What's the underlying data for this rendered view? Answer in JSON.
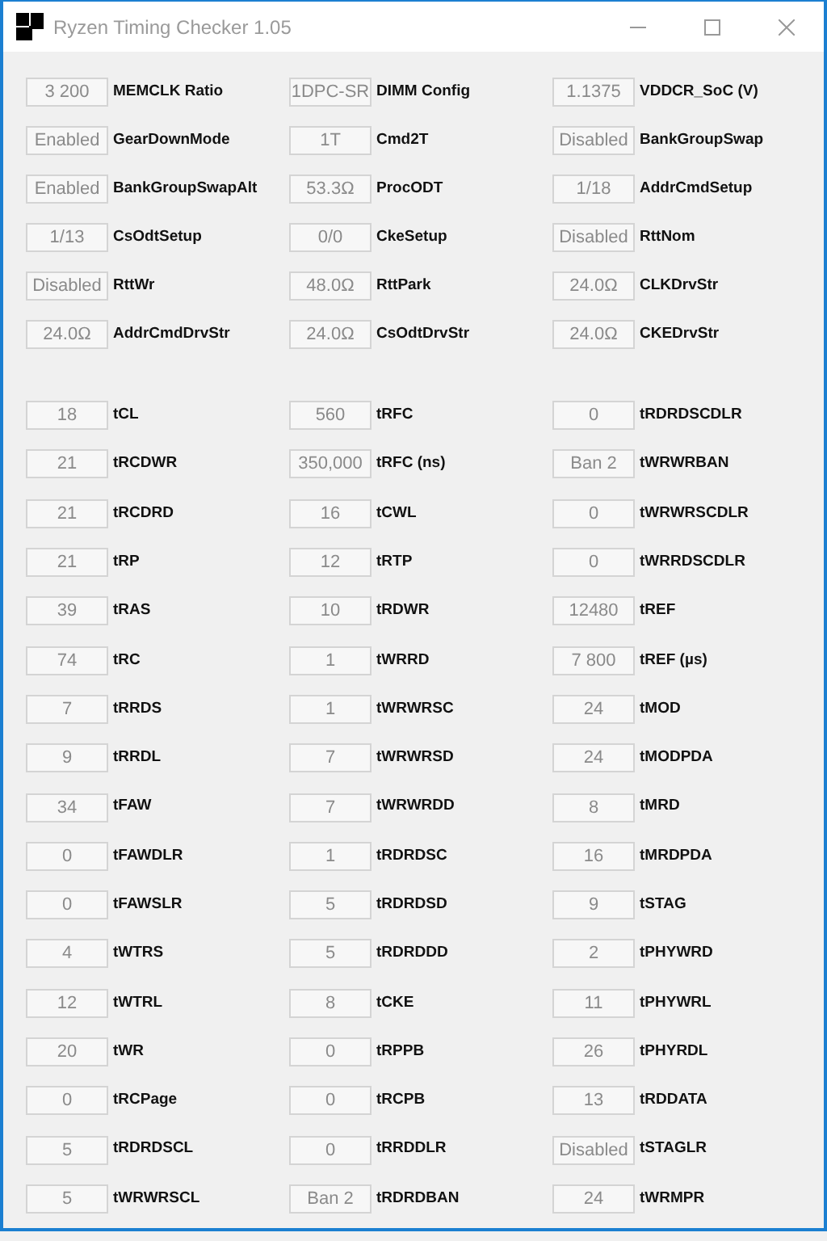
{
  "window": {
    "title": "Ryzen Timing Checker 1.05"
  },
  "settings": [
    {
      "value": "3 200",
      "label": "MEMCLK Ratio"
    },
    {
      "value": "1DPC-SR",
      "label": "DIMM Config"
    },
    {
      "value": "1.1375",
      "label": "VDDCR_SoC (V)"
    },
    {
      "value": "Enabled",
      "label": "GearDownMode"
    },
    {
      "value": "1T",
      "label": "Cmd2T"
    },
    {
      "value": "Disabled",
      "label": "BankGroupSwap"
    },
    {
      "value": "Enabled",
      "label": "BankGroupSwapAlt"
    },
    {
      "value": "53.3Ω",
      "label": "ProcODT"
    },
    {
      "value": "1/18",
      "label": "AddrCmdSetup"
    },
    {
      "value": "1/13",
      "label": "CsOdtSetup"
    },
    {
      "value": "0/0",
      "label": "CkeSetup"
    },
    {
      "value": "Disabled",
      "label": "RttNom"
    },
    {
      "value": "Disabled",
      "label": "RttWr"
    },
    {
      "value": "48.0Ω",
      "label": "RttPark"
    },
    {
      "value": "24.0Ω",
      "label": "CLKDrvStr"
    },
    {
      "value": "24.0Ω",
      "label": "AddrCmdDrvStr"
    },
    {
      "value": "24.0Ω",
      "label": "CsOdtDrvStr"
    },
    {
      "value": "24.0Ω",
      "label": "CKEDrvStr"
    }
  ],
  "timings": [
    {
      "value": "18",
      "label": "tCL"
    },
    {
      "value": "560",
      "label": "tRFC"
    },
    {
      "value": "0",
      "label": "tRDRDSCDLR"
    },
    {
      "value": "21",
      "label": "tRCDWR"
    },
    {
      "value": "350,000",
      "label": "tRFC (ns)"
    },
    {
      "value": "Ban 2",
      "label": "tWRWRBAN"
    },
    {
      "value": "21",
      "label": "tRCDRD"
    },
    {
      "value": "16",
      "label": "tCWL"
    },
    {
      "value": "0",
      "label": "tWRWRSCDLR"
    },
    {
      "value": "21",
      "label": "tRP"
    },
    {
      "value": "12",
      "label": "tRTP"
    },
    {
      "value": "0",
      "label": "tWRRDSCDLR"
    },
    {
      "value": "39",
      "label": "tRAS"
    },
    {
      "value": "10",
      "label": "tRDWR"
    },
    {
      "value": "12480",
      "label": "tREF"
    },
    {
      "value": "74",
      "label": "tRC"
    },
    {
      "value": "1",
      "label": "tWRRD"
    },
    {
      "value": "7 800",
      "label": "tREF (µs)"
    },
    {
      "value": "7",
      "label": "tRRDS"
    },
    {
      "value": "1",
      "label": "tWRWRSC"
    },
    {
      "value": "24",
      "label": "tMOD"
    },
    {
      "value": "9",
      "label": "tRRDL"
    },
    {
      "value": "7",
      "label": "tWRWRSD"
    },
    {
      "value": "24",
      "label": "tMODPDA"
    },
    {
      "value": "34",
      "label": "tFAW"
    },
    {
      "value": "7",
      "label": "tWRWRDD"
    },
    {
      "value": "8",
      "label": "tMRD"
    },
    {
      "value": "0",
      "label": "tFAWDLR"
    },
    {
      "value": "1",
      "label": "tRDRDSC"
    },
    {
      "value": "16",
      "label": "tMRDPDA"
    },
    {
      "value": "0",
      "label": "tFAWSLR"
    },
    {
      "value": "5",
      "label": "tRDRDSD"
    },
    {
      "value": "9",
      "label": "tSTAG"
    },
    {
      "value": "4",
      "label": "tWTRS"
    },
    {
      "value": "5",
      "label": "tRDRDDD"
    },
    {
      "value": "2",
      "label": "tPHYWRD"
    },
    {
      "value": "12",
      "label": "tWTRL"
    },
    {
      "value": "8",
      "label": "tCKE"
    },
    {
      "value": "11",
      "label": "tPHYWRL"
    },
    {
      "value": "20",
      "label": "tWR"
    },
    {
      "value": "0",
      "label": "tRPPB"
    },
    {
      "value": "26",
      "label": "tPHYRDL"
    },
    {
      "value": "0",
      "label": "tRCPage"
    },
    {
      "value": "0",
      "label": "tRCPB"
    },
    {
      "value": "13",
      "label": "tRDDATA"
    },
    {
      "value": "5",
      "label": "tRDRDSCL"
    },
    {
      "value": "0",
      "label": "tRRDDLR"
    },
    {
      "value": "Disabled",
      "label": "tSTAGLR"
    },
    {
      "value": "5",
      "label": "tWRWRSCL"
    },
    {
      "value": "Ban 2",
      "label": "tRDRDBAN"
    },
    {
      "value": "24",
      "label": "tWRMPR"
    }
  ]
}
